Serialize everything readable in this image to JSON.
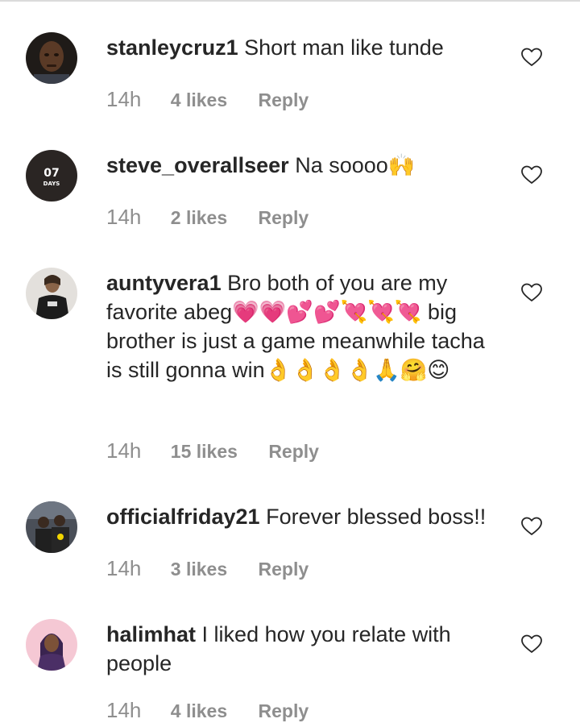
{
  "comments": [
    {
      "username": "stanleycruz1",
      "text": "Short man like tunde",
      "emoji": "",
      "time": "14h",
      "likes": "4 likes",
      "reply": "Reply",
      "avatar_icon": "profile-photo"
    },
    {
      "username": "steve_overallseer",
      "text": "Na soooo",
      "emoji": "🙌",
      "time": "14h",
      "likes": "2 likes",
      "reply": "Reply",
      "avatar_text": "07",
      "avatar_subtext": "DAYS"
    },
    {
      "username": "auntyvera1",
      "text": "Bro both of you are my favorite abeg💗💗💕💕💘💘💘 big brother is just a game meanwhile tacha is still gonna win👌👌👌👌🙏🤗😊",
      "emoji": "",
      "time": "14h",
      "likes": "15 likes",
      "reply": "Reply",
      "avatar_icon": "profile-photo"
    },
    {
      "username": "officialfriday21",
      "text": "Forever blessed boss!!",
      "emoji": "",
      "time": "14h",
      "likes": "3 likes",
      "reply": "Reply",
      "avatar_icon": "profile-photo"
    },
    {
      "username": "halimhat",
      "text": "I liked how you relate with people",
      "emoji": "",
      "time": "14h",
      "likes": "4 likes",
      "reply": "Reply",
      "avatar_icon": "profile-photo"
    }
  ],
  "colors": {
    "text": "#262626",
    "meta": "#8e8e8e",
    "divider": "#dbdbdb"
  },
  "icons": {
    "like": "heart-outline-icon"
  }
}
